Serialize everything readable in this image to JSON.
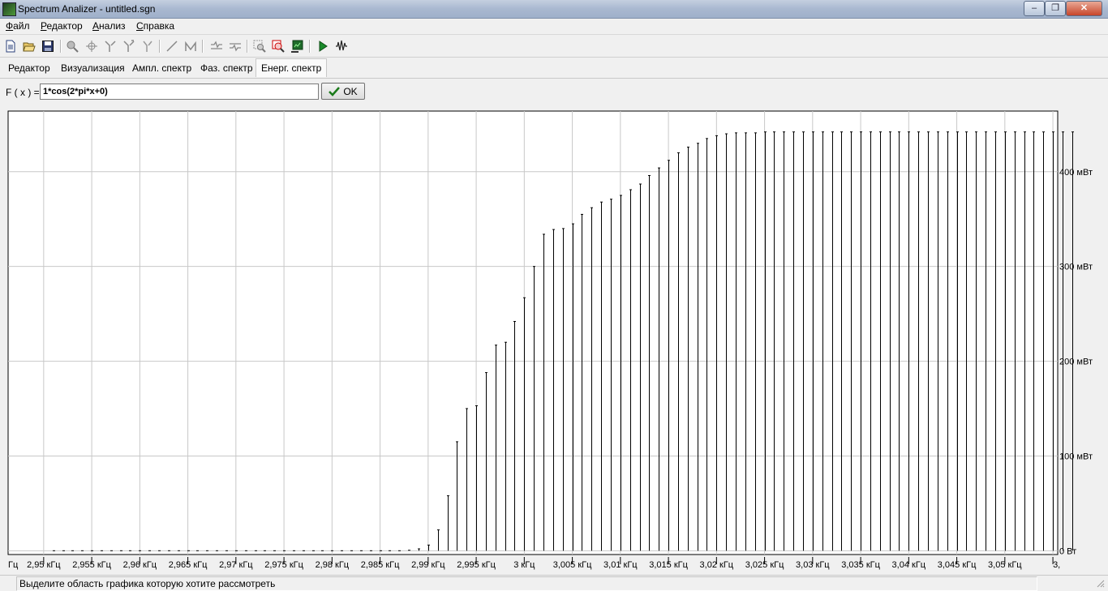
{
  "window": {
    "title": "Spectrum Analizer - untitled.sgn"
  },
  "menu": [
    {
      "label": "Файл",
      "accel": "Ф",
      "rest": "айл"
    },
    {
      "label": "Редактор",
      "accel": "Р",
      "rest": "едактор"
    },
    {
      "label": "Анализ",
      "accel": "А",
      "rest": "нализ"
    },
    {
      "label": "Справка",
      "accel": "С",
      "rest": "правка"
    }
  ],
  "toolbar_icons": [
    "new-file-icon",
    "open-folder-icon",
    "save-icon",
    "zoom-icon",
    "crosshair-icon",
    "cursor-a-icon",
    "cursor-b-icon",
    "cursor-c-icon",
    "line-icon",
    "peak-icon",
    "filter-a-icon",
    "filter-b-icon",
    "zoom-region-icon",
    "zoom-reset-icon",
    "export-icon",
    "play-icon",
    "waveform-icon"
  ],
  "tabs": [
    {
      "label": "Редактор",
      "active": false
    },
    {
      "label": "Визуализация",
      "active": false
    },
    {
      "label": "Ампл. спектр",
      "active": false
    },
    {
      "label": "Фаз. спектр",
      "active": false
    },
    {
      "label": "Енерг. спектр",
      "active": true
    }
  ],
  "formula": {
    "label": "F ( x ) =",
    "value": "1*cos(2*pi*x+0)",
    "ok_label": "OK"
  },
  "chart_data": {
    "type": "bar",
    "x_unit_label": "Гц",
    "x_tick_labels": [
      "2,95 кГц",
      "2,955 кГц",
      "2,96 кГц",
      "2,965 кГц",
      "2,97 кГц",
      "2,975 кГц",
      "2,98 кГц",
      "2,985 кГц",
      "2,99 кГц",
      "2,995 кГц",
      "3 кГц",
      "3,005 кГц",
      "3,01 кГц",
      "3,015 кГц",
      "3,02 кГц",
      "3,025 кГц",
      "3,03 кГц",
      "3,035 кГц",
      "3,04 кГц",
      "3,045 кГц",
      "3,05 кГц",
      "3,"
    ],
    "x_ticks": [
      2.95,
      2.955,
      2.96,
      2.965,
      2.97,
      2.975,
      2.98,
      2.985,
      2.99,
      2.995,
      3.0,
      3.005,
      3.01,
      3.015,
      3.02,
      3.025,
      3.03,
      3.035,
      3.04,
      3.045,
      3.05,
      3.055
    ],
    "xlim": [
      2.9463,
      3.0555
    ],
    "y_tick_labels": [
      "0 Вт",
      "100 мВт",
      "200 мВт",
      "300 мВт",
      "400 мВт"
    ],
    "y_ticks": [
      0,
      100,
      200,
      300,
      400
    ],
    "ylim": [
      -4,
      464
    ],
    "ylabel_units": "мВт",
    "x_start": 2.951,
    "x_step": 0.001,
    "values": [
      0,
      0,
      0,
      0,
      0,
      0,
      0,
      0,
      0,
      0,
      0,
      0,
      0,
      0,
      0,
      0,
      0,
      0,
      0,
      0,
      0,
      0,
      0,
      0,
      0,
      0,
      0,
      0,
      0,
      0,
      0,
      0,
      0,
      0,
      0,
      0,
      0,
      0.5,
      2,
      6,
      22,
      58,
      115,
      150,
      153,
      188,
      217,
      220,
      242,
      267,
      300,
      334,
      339,
      340,
      345,
      355,
      362,
      368,
      371,
      375,
      381,
      387,
      396,
      404,
      412,
      420,
      426,
      430,
      435,
      438,
      440,
      441,
      441,
      441,
      442,
      442,
      442,
      442,
      442,
      442,
      442,
      442,
      442,
      442,
      442,
      442,
      442,
      442,
      442,
      442,
      442,
      442,
      442,
      442,
      442,
      442,
      442,
      442,
      442,
      442,
      442,
      442,
      442,
      442,
      442,
      442,
      442
    ],
    "grid": true,
    "y_axis_side": "right"
  },
  "status": {
    "text": "Выделите область графика которую хотите рассмотреть"
  }
}
